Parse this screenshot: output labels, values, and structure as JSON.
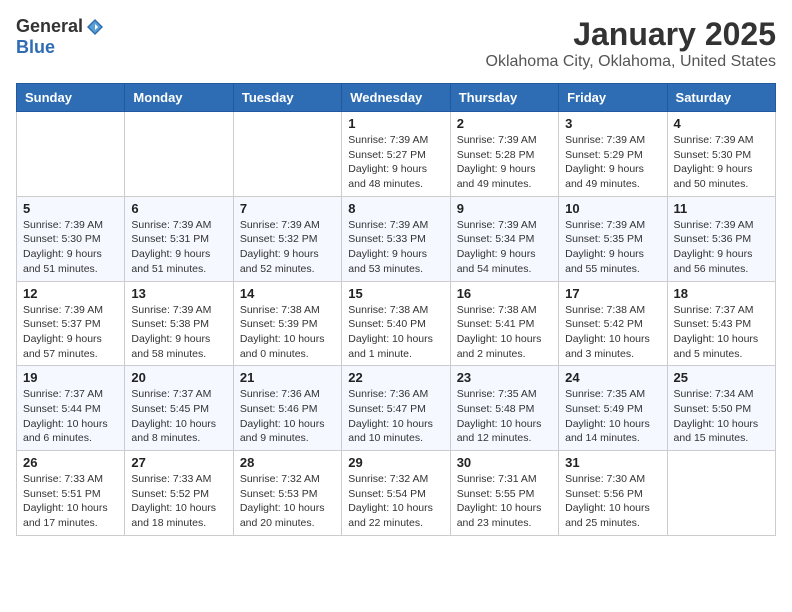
{
  "header": {
    "logo_general": "General",
    "logo_blue": "Blue",
    "title": "January 2025",
    "subtitle": "Oklahoma City, Oklahoma, United States"
  },
  "weekdays": [
    "Sunday",
    "Monday",
    "Tuesday",
    "Wednesday",
    "Thursday",
    "Friday",
    "Saturday"
  ],
  "weeks": [
    [
      {
        "day": "",
        "info": ""
      },
      {
        "day": "",
        "info": ""
      },
      {
        "day": "",
        "info": ""
      },
      {
        "day": "1",
        "info": "Sunrise: 7:39 AM\nSunset: 5:27 PM\nDaylight: 9 hours\nand 48 minutes."
      },
      {
        "day": "2",
        "info": "Sunrise: 7:39 AM\nSunset: 5:28 PM\nDaylight: 9 hours\nand 49 minutes."
      },
      {
        "day": "3",
        "info": "Sunrise: 7:39 AM\nSunset: 5:29 PM\nDaylight: 9 hours\nand 49 minutes."
      },
      {
        "day": "4",
        "info": "Sunrise: 7:39 AM\nSunset: 5:30 PM\nDaylight: 9 hours\nand 50 minutes."
      }
    ],
    [
      {
        "day": "5",
        "info": "Sunrise: 7:39 AM\nSunset: 5:30 PM\nDaylight: 9 hours\nand 51 minutes."
      },
      {
        "day": "6",
        "info": "Sunrise: 7:39 AM\nSunset: 5:31 PM\nDaylight: 9 hours\nand 51 minutes."
      },
      {
        "day": "7",
        "info": "Sunrise: 7:39 AM\nSunset: 5:32 PM\nDaylight: 9 hours\nand 52 minutes."
      },
      {
        "day": "8",
        "info": "Sunrise: 7:39 AM\nSunset: 5:33 PM\nDaylight: 9 hours\nand 53 minutes."
      },
      {
        "day": "9",
        "info": "Sunrise: 7:39 AM\nSunset: 5:34 PM\nDaylight: 9 hours\nand 54 minutes."
      },
      {
        "day": "10",
        "info": "Sunrise: 7:39 AM\nSunset: 5:35 PM\nDaylight: 9 hours\nand 55 minutes."
      },
      {
        "day": "11",
        "info": "Sunrise: 7:39 AM\nSunset: 5:36 PM\nDaylight: 9 hours\nand 56 minutes."
      }
    ],
    [
      {
        "day": "12",
        "info": "Sunrise: 7:39 AM\nSunset: 5:37 PM\nDaylight: 9 hours\nand 57 minutes."
      },
      {
        "day": "13",
        "info": "Sunrise: 7:39 AM\nSunset: 5:38 PM\nDaylight: 9 hours\nand 58 minutes."
      },
      {
        "day": "14",
        "info": "Sunrise: 7:38 AM\nSunset: 5:39 PM\nDaylight: 10 hours\nand 0 minutes."
      },
      {
        "day": "15",
        "info": "Sunrise: 7:38 AM\nSunset: 5:40 PM\nDaylight: 10 hours\nand 1 minute."
      },
      {
        "day": "16",
        "info": "Sunrise: 7:38 AM\nSunset: 5:41 PM\nDaylight: 10 hours\nand 2 minutes."
      },
      {
        "day": "17",
        "info": "Sunrise: 7:38 AM\nSunset: 5:42 PM\nDaylight: 10 hours\nand 3 minutes."
      },
      {
        "day": "18",
        "info": "Sunrise: 7:37 AM\nSunset: 5:43 PM\nDaylight: 10 hours\nand 5 minutes."
      }
    ],
    [
      {
        "day": "19",
        "info": "Sunrise: 7:37 AM\nSunset: 5:44 PM\nDaylight: 10 hours\nand 6 minutes."
      },
      {
        "day": "20",
        "info": "Sunrise: 7:37 AM\nSunset: 5:45 PM\nDaylight: 10 hours\nand 8 minutes."
      },
      {
        "day": "21",
        "info": "Sunrise: 7:36 AM\nSunset: 5:46 PM\nDaylight: 10 hours\nand 9 minutes."
      },
      {
        "day": "22",
        "info": "Sunrise: 7:36 AM\nSunset: 5:47 PM\nDaylight: 10 hours\nand 10 minutes."
      },
      {
        "day": "23",
        "info": "Sunrise: 7:35 AM\nSunset: 5:48 PM\nDaylight: 10 hours\nand 12 minutes."
      },
      {
        "day": "24",
        "info": "Sunrise: 7:35 AM\nSunset: 5:49 PM\nDaylight: 10 hours\nand 14 minutes."
      },
      {
        "day": "25",
        "info": "Sunrise: 7:34 AM\nSunset: 5:50 PM\nDaylight: 10 hours\nand 15 minutes."
      }
    ],
    [
      {
        "day": "26",
        "info": "Sunrise: 7:33 AM\nSunset: 5:51 PM\nDaylight: 10 hours\nand 17 minutes."
      },
      {
        "day": "27",
        "info": "Sunrise: 7:33 AM\nSunset: 5:52 PM\nDaylight: 10 hours\nand 18 minutes."
      },
      {
        "day": "28",
        "info": "Sunrise: 7:32 AM\nSunset: 5:53 PM\nDaylight: 10 hours\nand 20 minutes."
      },
      {
        "day": "29",
        "info": "Sunrise: 7:32 AM\nSunset: 5:54 PM\nDaylight: 10 hours\nand 22 minutes."
      },
      {
        "day": "30",
        "info": "Sunrise: 7:31 AM\nSunset: 5:55 PM\nDaylight: 10 hours\nand 23 minutes."
      },
      {
        "day": "31",
        "info": "Sunrise: 7:30 AM\nSunset: 5:56 PM\nDaylight: 10 hours\nand 25 minutes."
      },
      {
        "day": "",
        "info": ""
      }
    ]
  ]
}
